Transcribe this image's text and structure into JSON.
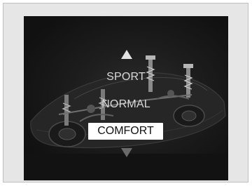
{
  "modes": {
    "options": [
      "SPORT",
      "NORMAL",
      "COMFORT"
    ],
    "sport_label": "SPORT",
    "normal_label": "NORMAL",
    "comfort_label": "COMFORT",
    "selected": "COMFORT"
  },
  "icons": {
    "up": "arrow-up-icon",
    "down": "arrow-down-icon",
    "background": "car-chassis-icon"
  },
  "colors": {
    "screen_background": "#1d1d1d",
    "selection_highlight": "#ffffff",
    "text": "#d8d8d8"
  }
}
